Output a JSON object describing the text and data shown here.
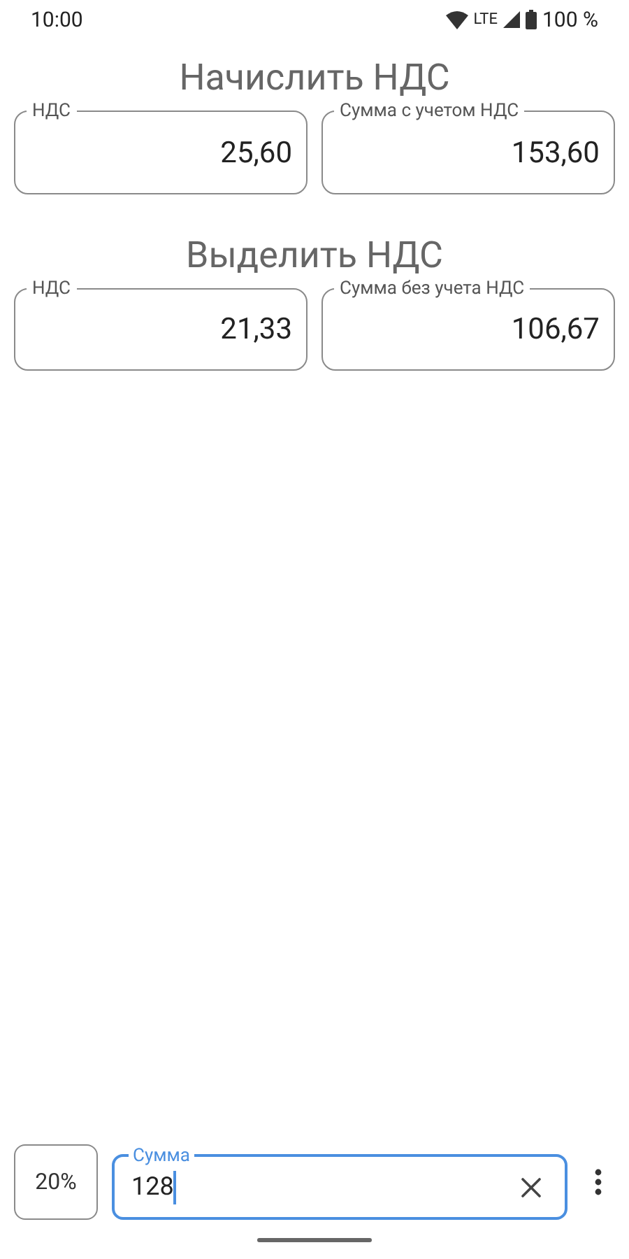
{
  "status_bar": {
    "time": "10:00",
    "network": "LTE",
    "battery": "100 %"
  },
  "sections": [
    {
      "title": "Начислить НДС",
      "fields": [
        {
          "label": "НДС",
          "value": "25,60"
        },
        {
          "label": "Сумма с учетом НДС",
          "value": "153,60"
        }
      ]
    },
    {
      "title": "Выделить НДС",
      "fields": [
        {
          "label": "НДС",
          "value": "21,33"
        },
        {
          "label": "Сумма без учета НДС",
          "value": "106,67"
        }
      ]
    }
  ],
  "bottom_bar": {
    "rate": "20%",
    "amount": {
      "label": "Сумма",
      "value": "128",
      "focused": true
    }
  }
}
